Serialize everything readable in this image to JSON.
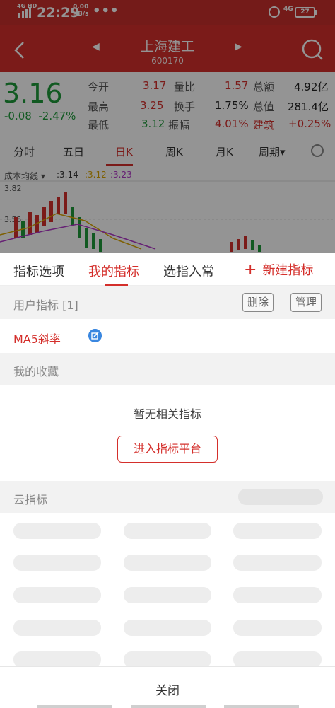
{
  "status_bar": {
    "network_tag": "4G HD",
    "time": "22:29",
    "speed_value": "0.00",
    "speed_unit": "KB/s",
    "more": "•••",
    "net_type": "4G",
    "battery": "27"
  },
  "header": {
    "stock_name": "上海建工",
    "stock_code": "600170",
    "back_icon": "chevron-left-icon",
    "search_icon": "search-icon",
    "prev_icon": "triangle-left-icon",
    "next_icon": "triangle-right-icon"
  },
  "quote": {
    "price": "3.16",
    "change": "-0.08",
    "change_pct": "-2.47%",
    "fields": [
      {
        "label": "今开",
        "value": "3.17"
      },
      {
        "label": "量比",
        "value": "1.57"
      },
      {
        "label": "总额",
        "value": "4.92亿"
      },
      {
        "label": "最高",
        "value": "3.25"
      },
      {
        "label": "换手",
        "value": "1.75%"
      },
      {
        "label": "总值",
        "value": "281.4亿"
      },
      {
        "label": "最低",
        "value": "3.12"
      },
      {
        "label": "振幅",
        "value": "4.01%"
      },
      {
        "label": "建筑",
        "value": "+0.25%"
      }
    ]
  },
  "kline_tabs": [
    "分时",
    "五日",
    "日K",
    "周K",
    "月K",
    "周期"
  ],
  "kline_tab_active": "日K",
  "kline_period_caret": "▾",
  "ma_bar": {
    "label": "成本均线",
    "caret": "▾",
    "values": [
      ":3.14",
      ":3.12",
      ":3.23"
    ],
    "colors": [
      "#333333",
      "#d9a400",
      "#b037c8"
    ]
  },
  "kline_axis": {
    "top": "3.82",
    "mid": "3.55"
  },
  "sheet": {
    "tabs": [
      "指标选项",
      "我的指标",
      "选指入常"
    ],
    "active_tab": "我的指标",
    "new_button": "新建指标",
    "new_plus": "+",
    "user_section": "用户指标 [1]",
    "delete_button": "删除",
    "manage_button": "管理",
    "indicator_items": [
      {
        "name": "MA5斜率",
        "edit_icon": "edit-icon"
      }
    ],
    "favorites_section": "我的收藏",
    "empty_text": "暂无相关指标",
    "enter_platform_button": "进入指标平台",
    "cloud_section": "云指标",
    "close_button": "关闭"
  },
  "colors": {
    "brand_red": "#d42f2b",
    "down_green": "#1e9a3a",
    "edit_blue": "#3a87e0"
  }
}
